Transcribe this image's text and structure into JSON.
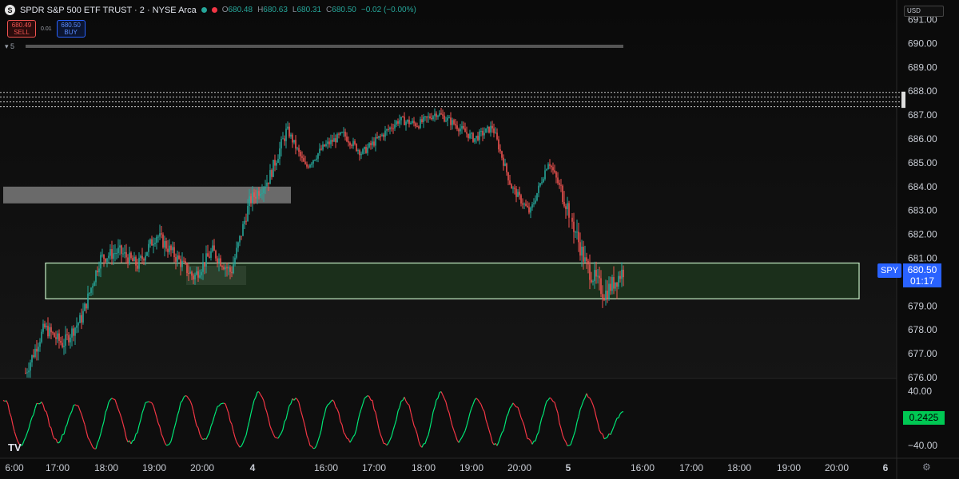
{
  "header": {
    "symbol_icon": "S",
    "title": "SPDR S&P 500 ETF TRUST · 2 · NYSE Arca",
    "status_dot_color": "#26a69a",
    "alert_dot_color": "#f23645",
    "ohlc": {
      "o_label": "O",
      "o": "680.48",
      "h_label": "H",
      "h": "680.63",
      "l_label": "L",
      "l": "680.31",
      "c_label": "C",
      "c": "680.50",
      "change": "−0.02 (−0.00%)"
    }
  },
  "trade": {
    "sell_price": "680.49",
    "sell_label": "SELL",
    "spread": "0.01",
    "buy_price": "680.50",
    "buy_label": "BUY"
  },
  "indicator_collapse": {
    "count": "5"
  },
  "currency": "USD",
  "last_price": {
    "symbol": "SPY",
    "price": "680.50",
    "countdown": "01:17"
  },
  "oscillator_value": "0.2425",
  "logo_text": "TV",
  "icons": {
    "settings": "gear-icon",
    "collapse": "chevron-icon",
    "symbol": "logo-icon"
  },
  "colors": {
    "up": "#26a69a",
    "down": "#ef5350",
    "osc_up": "#00e676",
    "osc_down": "#f23645",
    "zone_border": "#c8f0c8",
    "accent": "#2962ff"
  },
  "chart_data": [
    {
      "type": "candlestick",
      "title": "SPDR S&P 500 ETF TRUST · 2 · NYSE Arca",
      "ylim": [
        676,
        691
      ],
      "ytick_labels": [
        "676.00",
        "677.00",
        "678.00",
        "679.00",
        "680.00",
        "681.00",
        "682.00",
        "683.00",
        "684.00",
        "685.00",
        "686.00",
        "687.00",
        "688.00",
        "689.00",
        "690.00",
        "691.00"
      ],
      "xtick_labels": [
        "6:00",
        "17:00",
        "18:00",
        "19:00",
        "20:00",
        "4",
        "16:00",
        "17:00",
        "18:00",
        "19:00",
        "20:00",
        "5",
        "16:00",
        "17:00",
        "18:00",
        "19:00",
        "20:00",
        "6"
      ],
      "path_keypoints": [
        676.2,
        678.1,
        677.4,
        678.5,
        681.0,
        681.3,
        680.7,
        682.0,
        681.1,
        680.2,
        681.3,
        680.4,
        683.4,
        684.3,
        686.4,
        684.8,
        685.7,
        686.2,
        685.4,
        686.1,
        686.8,
        686.6,
        687.1,
        686.6,
        686.0,
        686.5,
        684.0,
        682.9,
        685.1,
        683.2,
        680.7,
        679.5,
        680.5
      ],
      "zones": [
        {
          "y_top": 684.0,
          "y_bottom": 683.3,
          "color": "#888888"
        },
        {
          "y_top": 680.8,
          "y_bottom": 679.3,
          "color": "#2f5a2f"
        }
      ],
      "dotted_levels": [
        687.95,
        687.75,
        687.55,
        687.35
      ]
    },
    {
      "type": "line",
      "name": "oscillator",
      "ytick_labels": [
        "40.00",
        "−40.00"
      ],
      "ylim": [
        -60,
        60
      ],
      "keypoints": [
        30,
        -40,
        25,
        -35,
        20,
        -45,
        32,
        -38,
        28,
        -40,
        35,
        -32,
        25,
        -42,
        38,
        -30,
        30,
        -45,
        28,
        -35,
        35,
        -40,
        30,
        -42,
        38,
        -35,
        30,
        -40,
        22,
        -38,
        32,
        -42,
        36,
        -30,
        8
      ],
      "last_value": 0.2425
    }
  ]
}
